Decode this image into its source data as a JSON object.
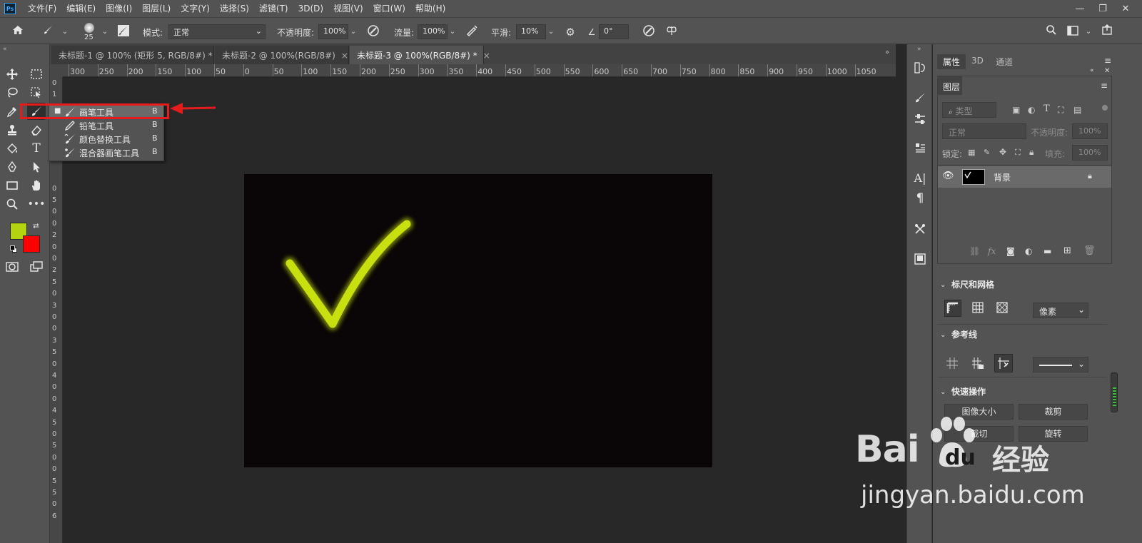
{
  "menubar": {
    "logo": "Ps",
    "items": [
      "文件(F)",
      "编辑(E)",
      "图像(I)",
      "图层(L)",
      "文字(Y)",
      "选择(S)",
      "滤镜(T)",
      "3D(D)",
      "视图(V)",
      "窗口(W)",
      "帮助(H)"
    ],
    "win_controls": [
      "—",
      "❐",
      "✕"
    ]
  },
  "options": {
    "brush_size": "25",
    "mode_label": "模式:",
    "mode_value": "正常",
    "opacity_label": "不透明度:",
    "opacity_value": "100%",
    "flow_label": "流量:",
    "flow_value": "100%",
    "smooth_label": "平滑:",
    "smooth_value": "10%",
    "angle_value": "0°"
  },
  "tabs": [
    {
      "label": "未标题-1 @ 100% (矩形 5, RGB/8#) *",
      "close": "×"
    },
    {
      "label": "未标题-2 @ 100%(RGB/8#)",
      "close": "×"
    },
    {
      "label": "未标题-3 @ 100%(RGB/8#) *",
      "close": "×"
    }
  ],
  "ruler_h": [
    "300",
    "250",
    "200",
    "150",
    "100",
    "50",
    "0",
    "50",
    "100",
    "150",
    "200",
    "250",
    "300",
    "350",
    "400",
    "450",
    "500",
    "550",
    "600",
    "650",
    "700",
    "750",
    "800",
    "850",
    "900",
    "950",
    "1000",
    "1050"
  ],
  "ruler_v": [
    "0",
    "1",
    "5",
    "0",
    "",
    "",
    "",
    "",
    "",
    "0",
    "5",
    "0",
    "0",
    "2",
    "0",
    "0",
    "2",
    "5",
    "0",
    "3",
    "0",
    "0",
    "3",
    "5",
    "0",
    "4",
    "0",
    "0",
    "4",
    "5",
    "0",
    "5",
    "0",
    "0",
    "5",
    "5",
    "0",
    "6"
  ],
  "flyout": [
    {
      "label": "画笔工具",
      "key": "B",
      "selected": true
    },
    {
      "label": "铅笔工具",
      "key": "B",
      "selected": false
    },
    {
      "label": "颜色替换工具",
      "key": "B",
      "selected": false
    },
    {
      "label": "混合器画笔工具",
      "key": "B",
      "selected": false
    }
  ],
  "colors": {
    "foreground": "#b5d410",
    "background": "#ff0000",
    "stroke": "#c8e010",
    "highlight": "#e51c1c"
  },
  "panel": {
    "tabs": [
      "属性",
      "3D",
      "通道"
    ],
    "layers_title": "图层",
    "filter_label": "类型",
    "blend_mode": "正常",
    "opacity_label": "不透明度:",
    "opacity_value": "100%",
    "lock_label": "锁定:",
    "fill_label": "填充:",
    "fill_value": "100%",
    "layer_name": "背景",
    "rulers_grid_title": "标尺和网格",
    "unit_value": "像素",
    "guides_title": "参考线",
    "quick_actions_title": "快速操作",
    "btn_image_size": "图像大小",
    "btn_crop": "裁剪",
    "btn_trim": "裁切",
    "btn_rotate": "旋转"
  },
  "watermark": {
    "brand": "Bai",
    "brand_suffix": "du",
    "jingyan": "经验",
    "url": "jingyan.baidu.com"
  }
}
